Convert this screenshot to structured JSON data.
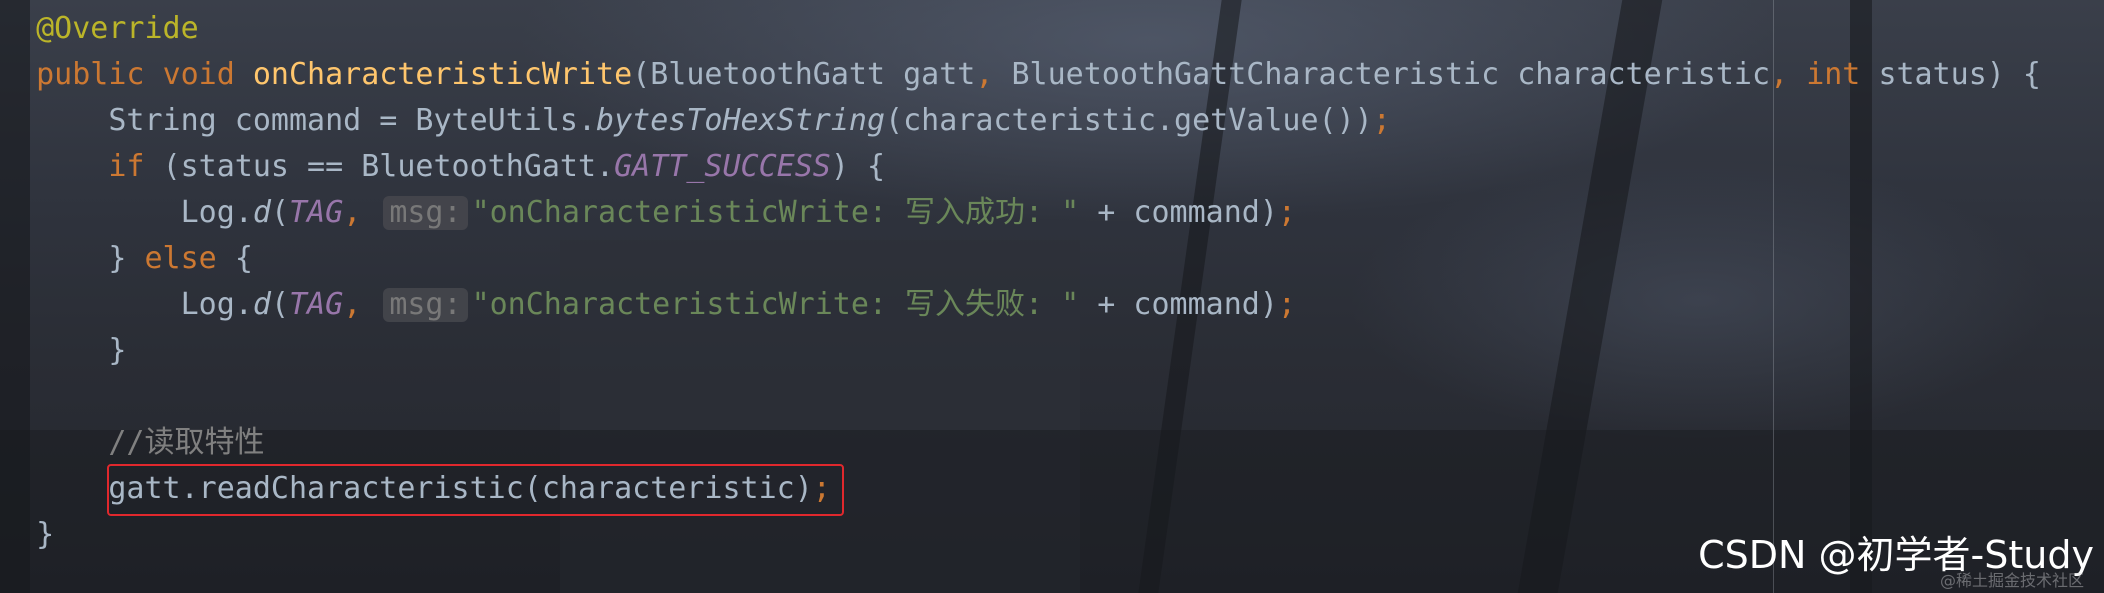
{
  "editor": {
    "lines": [
      {
        "indent": "",
        "tokens": [
          {
            "t": "@Override",
            "c": "ann"
          }
        ]
      },
      {
        "indent": "",
        "tokens": [
          {
            "t": "public ",
            "c": "kw"
          },
          {
            "t": "void ",
            "c": "kw"
          },
          {
            "t": "onCharacteristicWrite",
            "c": "fn"
          },
          {
            "t": "(BluetoothGatt gatt",
            "c": ""
          },
          {
            "t": ", ",
            "c": "kw"
          },
          {
            "t": "BluetoothGattCharacteristic characteristic",
            "c": ""
          },
          {
            "t": ", ",
            "c": "kw"
          },
          {
            "t": "int ",
            "c": "kw"
          },
          {
            "t": "status) {",
            "c": ""
          }
        ]
      },
      {
        "indent": "    ",
        "tokens": [
          {
            "t": "String command = ByteUtils.",
            "c": ""
          },
          {
            "t": "bytesToHexString",
            "c": "ital"
          },
          {
            "t": "(characteristic.getValue())",
            "c": ""
          },
          {
            "t": ";",
            "c": "kw"
          }
        ]
      },
      {
        "indent": "    ",
        "tokens": [
          {
            "t": "if ",
            "c": "kw"
          },
          {
            "t": "(status == BluetoothGatt.",
            "c": ""
          },
          {
            "t": "GATT_SUCCESS",
            "c": "const"
          },
          {
            "t": ") {",
            "c": ""
          }
        ]
      },
      {
        "indent": "        ",
        "tokens": [
          {
            "t": "Log.",
            "c": ""
          },
          {
            "t": "d",
            "c": "ital"
          },
          {
            "t": "(",
            "c": ""
          },
          {
            "t": "TAG",
            "c": "const"
          },
          {
            "t": ", ",
            "c": "kw"
          },
          {
            "t": "msg:",
            "c": "hint"
          },
          {
            "t": "\"onCharacteristicWrite: 写入成功: \"",
            "c": "str"
          },
          {
            "t": " + command)",
            "c": ""
          },
          {
            "t": ";",
            "c": "kw"
          }
        ]
      },
      {
        "indent": "    ",
        "tokens": [
          {
            "t": "} ",
            "c": ""
          },
          {
            "t": "else ",
            "c": "kw"
          },
          {
            "t": "{",
            "c": ""
          }
        ]
      },
      {
        "indent": "        ",
        "tokens": [
          {
            "t": "Log.",
            "c": ""
          },
          {
            "t": "d",
            "c": "ital"
          },
          {
            "t": "(",
            "c": ""
          },
          {
            "t": "TAG",
            "c": "const"
          },
          {
            "t": ", ",
            "c": "kw"
          },
          {
            "t": "msg:",
            "c": "hint"
          },
          {
            "t": "\"onCharacteristicWrite: 写入失败: \"",
            "c": "str"
          },
          {
            "t": " + command)",
            "c": ""
          },
          {
            "t": ";",
            "c": "kw"
          }
        ]
      },
      {
        "indent": "    ",
        "tokens": [
          {
            "t": "}",
            "c": ""
          }
        ]
      },
      {
        "indent": "",
        "tokens": []
      },
      {
        "indent": "    ",
        "tokens": [
          {
            "t": "//读取特性",
            "c": "cmt"
          }
        ]
      },
      {
        "indent": "    ",
        "tokens": [
          {
            "t": "gatt.readCharacteristic(characteristic)",
            "c": ""
          },
          {
            "t": ";",
            "c": "kw"
          }
        ]
      },
      {
        "indent": "",
        "tokens": [
          {
            "t": "}",
            "c": ""
          }
        ]
      }
    ],
    "highlighted_line": "gatt.readCharacteristic(characteristic);"
  },
  "watermark": {
    "primary": "CSDN @初学者-Study",
    "secondary": "@稀土掘金技术社区"
  },
  "colors": {
    "keyword": "#cc7832",
    "function": "#ffc66d",
    "annotation": "#bbb529",
    "constant": "#9876aa",
    "string": "#6a8759",
    "comment": "#808080",
    "text": "#a9b7c6",
    "highlight_border": "#e0282d"
  }
}
